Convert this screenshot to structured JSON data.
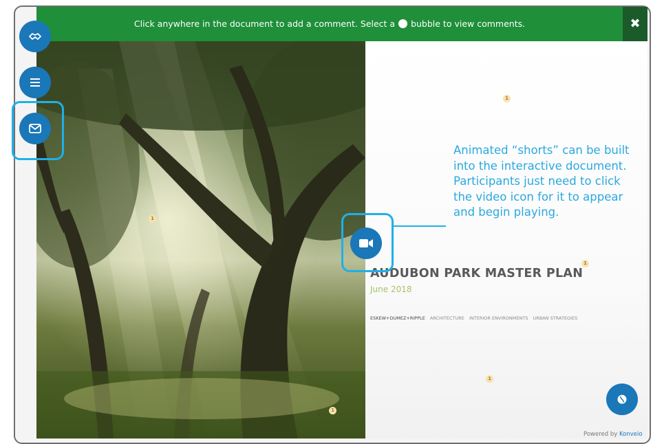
{
  "banner": {
    "text_before": "Click anywhere in the document to add a comment. Select a",
    "text_after": "bubble to view comments.",
    "close_label": "✖"
  },
  "side_nav": [
    {
      "name": "handshake-icon"
    },
    {
      "name": "menu-icon"
    },
    {
      "name": "mail-icon"
    }
  ],
  "document": {
    "title": "AUDUBON PARK MASTER PLAN",
    "date": "June 2018",
    "credits": {
      "firm": "ESKEW+DUMEZ+RIPPLE",
      "items": [
        "ARCHITECTURE",
        "INTERIOR ENVIRONMENTS",
        "URBAN STRATEGIES"
      ]
    },
    "comment_markers": [
      "1",
      "1",
      "1",
      "1",
      "1"
    ]
  },
  "callout": {
    "text": "Animated “shorts” can be built into the interactive document. Participants just need to click the video icon for it to appear and begin playing."
  },
  "footer": {
    "powered_by": "Powered by",
    "brand": "Konveio"
  },
  "colors": {
    "banner": "#1f8f3a",
    "button": "#1a77b8",
    "highlight": "#1fb0e8",
    "callout_text": "#29a9df"
  }
}
